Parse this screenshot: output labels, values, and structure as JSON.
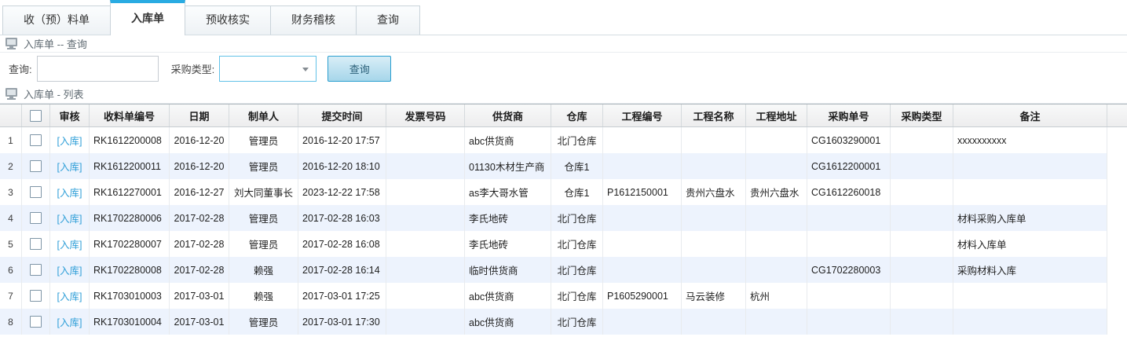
{
  "tabs": [
    {
      "label": "收（预）料单",
      "active": false
    },
    {
      "label": "入库单",
      "active": true
    },
    {
      "label": "预收核实",
      "active": false
    },
    {
      "label": "财务稽核",
      "active": false
    },
    {
      "label": "查询",
      "active": false
    }
  ],
  "sections": {
    "query_title": "入库单 -- 查询",
    "list_title": "入库单 - 列表"
  },
  "query_form": {
    "keyword_label": "查询:",
    "keyword_value": "",
    "keyword_placeholder": "",
    "purchase_type_label": "采购类型:",
    "purchase_type_value": "",
    "search_button_label": "查询"
  },
  "colors": {
    "accent": "#29abe2",
    "link": "#2f9fd8",
    "alt_row": "#edf3fd"
  },
  "table": {
    "audit_link_label": "[入库]",
    "columns": [
      "审核",
      "收料单编号",
      "日期",
      "制单人",
      "提交时间",
      "发票号码",
      "供货商",
      "仓库",
      "工程编号",
      "工程名称",
      "工程地址",
      "采购单号",
      "采购类型",
      "备注"
    ],
    "rows": [
      {
        "num": "1",
        "code": "RK1612200008",
        "date": "2016-12-20",
        "maker": "管理员",
        "submitted": "2016-12-20 17:57",
        "invoice": "",
        "supplier": "abc供货商",
        "warehouse": "北门仓库",
        "project_no": "",
        "project_name": "",
        "project_addr": "",
        "po_no": "CG1603290001",
        "po_type": "",
        "remark": "xxxxxxxxxx"
      },
      {
        "num": "2",
        "code": "RK1612200011",
        "date": "2016-12-20",
        "maker": "管理员",
        "submitted": "2016-12-20 18:10",
        "invoice": "",
        "supplier": "01130木材生产商",
        "warehouse": "仓库1",
        "project_no": "",
        "project_name": "",
        "project_addr": "",
        "po_no": "CG1612200001",
        "po_type": "",
        "remark": ""
      },
      {
        "num": "3",
        "code": "RK1612270001",
        "date": "2016-12-27",
        "maker": "刘大同董事长",
        "submitted": "2023-12-22 17:58",
        "invoice": "",
        "supplier": "as李大哥水管",
        "warehouse": "仓库1",
        "project_no": "P1612150001",
        "project_name": "贵州六盘水",
        "project_addr": "贵州六盘水",
        "po_no": "CG1612260018",
        "po_type": "",
        "remark": ""
      },
      {
        "num": "4",
        "code": "RK1702280006",
        "date": "2017-02-28",
        "maker": "管理员",
        "submitted": "2017-02-28 16:03",
        "invoice": "",
        "supplier": "李氏地砖",
        "warehouse": "北门仓库",
        "project_no": "",
        "project_name": "",
        "project_addr": "",
        "po_no": "",
        "po_type": "",
        "remark": "材料采购入库单"
      },
      {
        "num": "5",
        "code": "RK1702280007",
        "date": "2017-02-28",
        "maker": "管理员",
        "submitted": "2017-02-28 16:08",
        "invoice": "",
        "supplier": "李氏地砖",
        "warehouse": "北门仓库",
        "project_no": "",
        "project_name": "",
        "project_addr": "",
        "po_no": "",
        "po_type": "",
        "remark": "材料入库单"
      },
      {
        "num": "6",
        "code": "RK1702280008",
        "date": "2017-02-28",
        "maker": "赖强",
        "submitted": "2017-02-28 16:14",
        "invoice": "",
        "supplier": "临时供货商",
        "warehouse": "北门仓库",
        "project_no": "",
        "project_name": "",
        "project_addr": "",
        "po_no": "CG1702280003",
        "po_type": "",
        "remark": "采购材料入库"
      },
      {
        "num": "7",
        "code": "RK1703010003",
        "date": "2017-03-01",
        "maker": "赖强",
        "submitted": "2017-03-01 17:25",
        "invoice": "",
        "supplier": "abc供货商",
        "warehouse": "北门仓库",
        "project_no": "P1605290001",
        "project_name": "马云装修",
        "project_addr": "杭州",
        "po_no": "",
        "po_type": "",
        "remark": ""
      },
      {
        "num": "8",
        "code": "RK1703010004",
        "date": "2017-03-01",
        "maker": "管理员",
        "submitted": "2017-03-01 17:30",
        "invoice": "",
        "supplier": "abc供货商",
        "warehouse": "北门仓库",
        "project_no": "",
        "project_name": "",
        "project_addr": "",
        "po_no": "",
        "po_type": "",
        "remark": ""
      }
    ]
  }
}
